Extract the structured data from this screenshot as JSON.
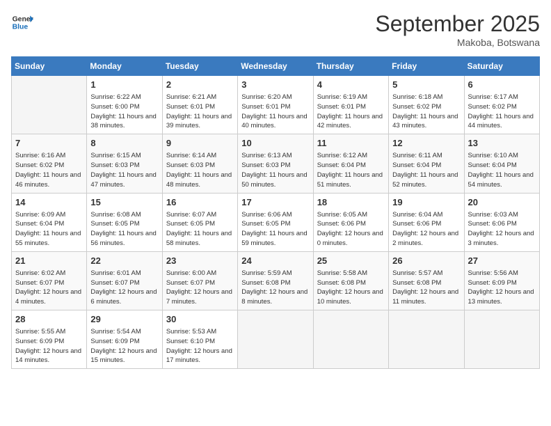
{
  "logo": {
    "line1": "General",
    "line2": "Blue"
  },
  "title": "September 2025",
  "location": "Makoba, Botswana",
  "weekdays": [
    "Sunday",
    "Monday",
    "Tuesday",
    "Wednesday",
    "Thursday",
    "Friday",
    "Saturday"
  ],
  "weeks": [
    [
      null,
      {
        "day": "1",
        "sunrise": "6:22 AM",
        "sunset": "6:00 PM",
        "daylight": "11 hours and 38 minutes."
      },
      {
        "day": "2",
        "sunrise": "6:21 AM",
        "sunset": "6:01 PM",
        "daylight": "11 hours and 39 minutes."
      },
      {
        "day": "3",
        "sunrise": "6:20 AM",
        "sunset": "6:01 PM",
        "daylight": "11 hours and 40 minutes."
      },
      {
        "day": "4",
        "sunrise": "6:19 AM",
        "sunset": "6:01 PM",
        "daylight": "11 hours and 42 minutes."
      },
      {
        "day": "5",
        "sunrise": "6:18 AM",
        "sunset": "6:02 PM",
        "daylight": "11 hours and 43 minutes."
      },
      {
        "day": "6",
        "sunrise": "6:17 AM",
        "sunset": "6:02 PM",
        "daylight": "11 hours and 44 minutes."
      }
    ],
    [
      {
        "day": "7",
        "sunrise": "6:16 AM",
        "sunset": "6:02 PM",
        "daylight": "11 hours and 46 minutes."
      },
      {
        "day": "8",
        "sunrise": "6:15 AM",
        "sunset": "6:03 PM",
        "daylight": "11 hours and 47 minutes."
      },
      {
        "day": "9",
        "sunrise": "6:14 AM",
        "sunset": "6:03 PM",
        "daylight": "11 hours and 48 minutes."
      },
      {
        "day": "10",
        "sunrise": "6:13 AM",
        "sunset": "6:03 PM",
        "daylight": "11 hours and 50 minutes."
      },
      {
        "day": "11",
        "sunrise": "6:12 AM",
        "sunset": "6:04 PM",
        "daylight": "11 hours and 51 minutes."
      },
      {
        "day": "12",
        "sunrise": "6:11 AM",
        "sunset": "6:04 PM",
        "daylight": "11 hours and 52 minutes."
      },
      {
        "day": "13",
        "sunrise": "6:10 AM",
        "sunset": "6:04 PM",
        "daylight": "11 hours and 54 minutes."
      }
    ],
    [
      {
        "day": "14",
        "sunrise": "6:09 AM",
        "sunset": "6:04 PM",
        "daylight": "11 hours and 55 minutes."
      },
      {
        "day": "15",
        "sunrise": "6:08 AM",
        "sunset": "6:05 PM",
        "daylight": "11 hours and 56 minutes."
      },
      {
        "day": "16",
        "sunrise": "6:07 AM",
        "sunset": "6:05 PM",
        "daylight": "11 hours and 58 minutes."
      },
      {
        "day": "17",
        "sunrise": "6:06 AM",
        "sunset": "6:05 PM",
        "daylight": "11 hours and 59 minutes."
      },
      {
        "day": "18",
        "sunrise": "6:05 AM",
        "sunset": "6:06 PM",
        "daylight": "12 hours and 0 minutes."
      },
      {
        "day": "19",
        "sunrise": "6:04 AM",
        "sunset": "6:06 PM",
        "daylight": "12 hours and 2 minutes."
      },
      {
        "day": "20",
        "sunrise": "6:03 AM",
        "sunset": "6:06 PM",
        "daylight": "12 hours and 3 minutes."
      }
    ],
    [
      {
        "day": "21",
        "sunrise": "6:02 AM",
        "sunset": "6:07 PM",
        "daylight": "12 hours and 4 minutes."
      },
      {
        "day": "22",
        "sunrise": "6:01 AM",
        "sunset": "6:07 PM",
        "daylight": "12 hours and 6 minutes."
      },
      {
        "day": "23",
        "sunrise": "6:00 AM",
        "sunset": "6:07 PM",
        "daylight": "12 hours and 7 minutes."
      },
      {
        "day": "24",
        "sunrise": "5:59 AM",
        "sunset": "6:08 PM",
        "daylight": "12 hours and 8 minutes."
      },
      {
        "day": "25",
        "sunrise": "5:58 AM",
        "sunset": "6:08 PM",
        "daylight": "12 hours and 10 minutes."
      },
      {
        "day": "26",
        "sunrise": "5:57 AM",
        "sunset": "6:08 PM",
        "daylight": "12 hours and 11 minutes."
      },
      {
        "day": "27",
        "sunrise": "5:56 AM",
        "sunset": "6:09 PM",
        "daylight": "12 hours and 13 minutes."
      }
    ],
    [
      {
        "day": "28",
        "sunrise": "5:55 AM",
        "sunset": "6:09 PM",
        "daylight": "12 hours and 14 minutes."
      },
      {
        "day": "29",
        "sunrise": "5:54 AM",
        "sunset": "6:09 PM",
        "daylight": "12 hours and 15 minutes."
      },
      {
        "day": "30",
        "sunrise": "5:53 AM",
        "sunset": "6:10 PM",
        "daylight": "12 hours and 17 minutes."
      },
      null,
      null,
      null,
      null
    ]
  ]
}
